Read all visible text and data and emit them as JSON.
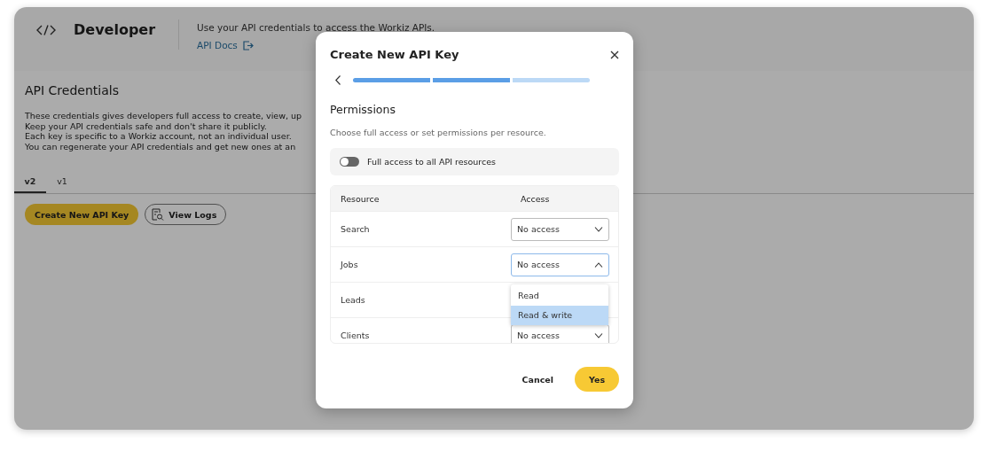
{
  "header": {
    "title": "Developer",
    "description": "Use your API credentials to access the Workiz APIs.",
    "docs_link": "API Docs"
  },
  "section": {
    "title": "API Credentials",
    "lines": [
      "These credentials gives developers full access to create, view, up",
      "Keep your API credentials safe and don't share it publicly.",
      "Each key is specific to a Workiz account, not an individual user.",
      "You can regenerate your API credentials and get new ones at an"
    ]
  },
  "tabs": [
    {
      "label": "v2",
      "selected": true
    },
    {
      "label": "v1",
      "selected": false
    }
  ],
  "buttons": [
    {
      "label": "Create New API Key",
      "kind": "primary"
    },
    {
      "label": "View Logs",
      "kind": "outline"
    }
  ],
  "modal": {
    "title": "Create New API Key",
    "steps": [
      {
        "done": true
      },
      {
        "done": true
      },
      {
        "done": false
      }
    ],
    "heading": "Permissions",
    "subtitle": "Choose full access or set permissions per resource.",
    "full_access": {
      "label": "Full access to all API resources",
      "on": false
    },
    "columns": [
      "Resource",
      "Access"
    ],
    "rows": [
      {
        "resource": "Search",
        "access": "No access",
        "open": false
      },
      {
        "resource": "Jobs",
        "access": "No access",
        "open": true
      },
      {
        "resource": "Leads"
      },
      {
        "resource": "Clients",
        "access": "No access",
        "open": false
      }
    ],
    "menu": [
      {
        "label": "Read",
        "selected": false
      },
      {
        "label": "Read & write",
        "selected": true
      }
    ],
    "cancel": "Cancel",
    "confirm": "Yes"
  }
}
